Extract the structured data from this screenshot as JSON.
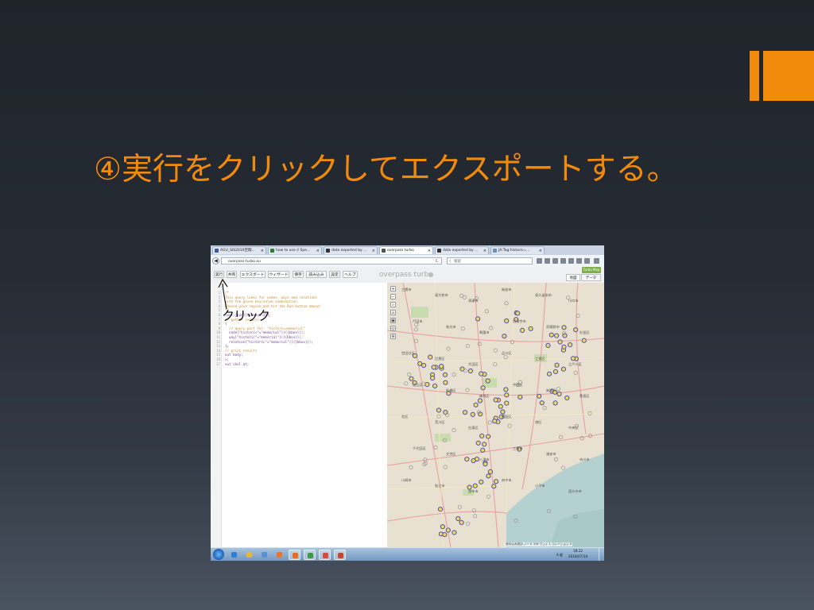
{
  "slide": {
    "title": "④実行をクリックしてエクスポートする。",
    "accent_color": "#f28a0c"
  },
  "browser": {
    "tabs": [
      {
        "label": "AGU_SIS2016空間...",
        "favicon_color": "#3b5998"
      },
      {
        "label": "how to use // Spe...",
        "favicon_color": "#2e7d32"
      },
      {
        "label": "data exported by ...",
        "favicon_color": "#333333"
      },
      {
        "label": "overpass turbo",
        "favicon_color": "#555555"
      },
      {
        "label": "data exported by ...",
        "favicon_color": "#333333"
      },
      {
        "label": "JA:Tag:historic=...",
        "favicon_color": "#6e8fb8"
      }
    ],
    "active_tab": 3,
    "url": "overpass-turbo.eu",
    "search_placeholder": "検索",
    "back_icon": "arrow-left-icon",
    "reload_symbol": "C"
  },
  "overpass": {
    "buttons": [
      "実行",
      "共有",
      "エクスポート",
      "ウィザード",
      "保存",
      "読み込み",
      "設定",
      "ヘルプ"
    ],
    "brand": "overpass turbo",
    "map_tabs": [
      "地図",
      "データ"
    ],
    "run_status": "Turbo Map"
  },
  "editor": {
    "lines": [
      {
        "t": "/*",
        "k": "comment"
      },
      {
        "t": "This query looks for nodes, ways and relations",
        "k": "comment"
      },
      {
        "t": "with the given key/value combination.",
        "k": "comment"
      },
      {
        "t": "Choose your region and hit the Run button above!",
        "k": "comment"
      },
      {
        "t": "*/",
        "k": "comment"
      },
      {
        "t": "[out:json][timeout:25];",
        "k": "kw"
      },
      {
        "t": "// gather results",
        "k": "comment"
      },
      {
        "t": "(",
        "k": "plain"
      },
      {
        "t": "  // query part for: \"historic=memorial\"",
        "k": "comment"
      },
      {
        "t": "  node[\"historic\"=\"memorial\"]({{bbox}});",
        "k": "kw"
      },
      {
        "t": "  way[\"historic\"=\"memorial\"]({{bbox}});",
        "k": "kw"
      },
      {
        "t": "  relation[\"historic\"=\"memorial\"]({{bbox}});",
        "k": "kw"
      },
      {
        "t": ");",
        "k": "plain"
      },
      {
        "t": "// print results",
        "k": "comment"
      },
      {
        "t": "out body;",
        "k": "kw"
      },
      {
        "t": ">;",
        "k": "kw"
      },
      {
        "t": "out skel qt;",
        "k": "kw"
      }
    ]
  },
  "map": {
    "zoom_controls": [
      "+",
      "−",
      "⌕",
      "⌂",
      "▣",
      "◎",
      "⊕"
    ],
    "places": [
      "三鷹市",
      "東大和市",
      "清瀬市",
      "新座市",
      "東久留米市",
      "川口市",
      "戸田市",
      "和光市",
      "朝霞市",
      "西東京市",
      "武蔵野市",
      "杉並区",
      "世田谷区",
      "目黒区",
      "大田区",
      "品川区",
      "江東区",
      "江戸川区",
      "足立区",
      "板橋区",
      "練馬区",
      "中野区",
      "新宿区",
      "豊島区",
      "北区",
      "荒川区",
      "台東区",
      "墨田区",
      "港区",
      "中央区",
      "千代田区",
      "文京区",
      "八潮市",
      "三郷市",
      "浦安市",
      "市川市",
      "川崎市",
      "狛江市",
      "調布市",
      "府中市",
      "小平市",
      "国分寺市"
    ],
    "attribution": "読み込み成功 ノード 376 ウェイ 1 リレーション 0"
  },
  "taskbar": {
    "apps": [
      "ie",
      "folder",
      "explorer",
      "media",
      "firefox",
      "chrome",
      "paint",
      "powerpoint"
    ],
    "time": "18:22",
    "date": "2016/07/14",
    "tray": "A  般"
  },
  "annotation": {
    "label": "クリック"
  }
}
